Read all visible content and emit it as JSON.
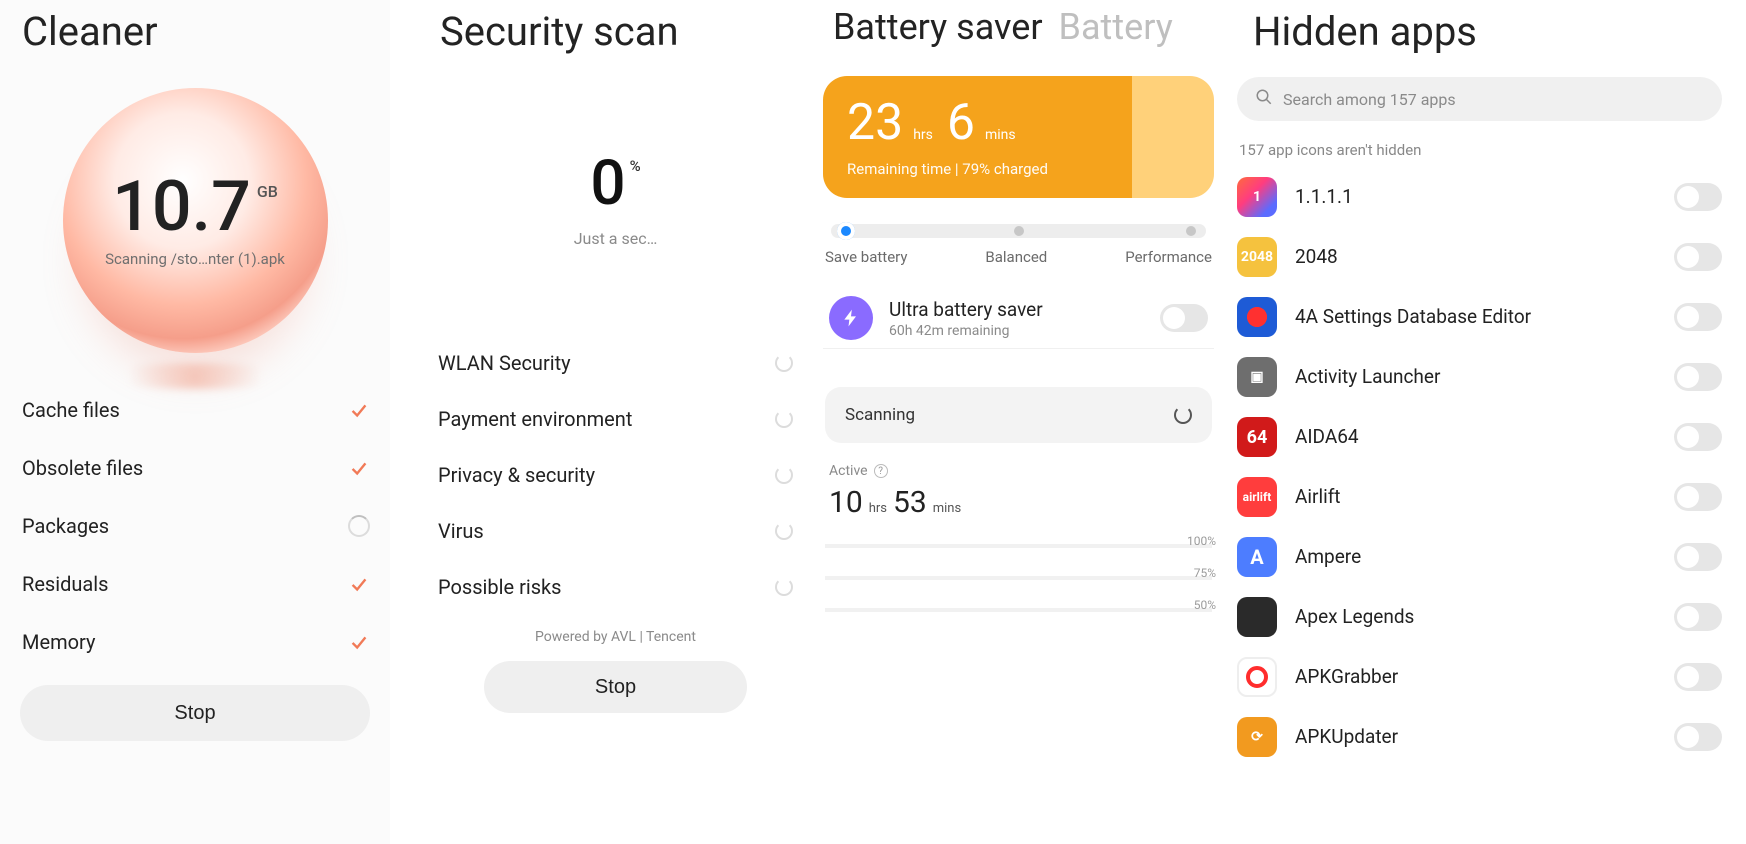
{
  "cleaner": {
    "title": "Cleaner",
    "size_value": "10.7",
    "size_unit": "GB",
    "scan_path": "Scanning /sto…nter (1).apk",
    "items": [
      {
        "label": "Cache files",
        "state": "done"
      },
      {
        "label": "Obsolete files",
        "state": "done"
      },
      {
        "label": "Packages",
        "state": "scanning"
      },
      {
        "label": "Residuals",
        "state": "done"
      },
      {
        "label": "Memory",
        "state": "done"
      }
    ],
    "stop_label": "Stop"
  },
  "security": {
    "title": "Security scan",
    "percent": "0",
    "percent_unit": "%",
    "status": "Just a sec…",
    "items": [
      "WLAN Security",
      "Payment environment",
      "Privacy & security",
      "Virus",
      "Possible risks"
    ],
    "powered": "Powered by AVL | Tencent",
    "stop_label": "Stop"
  },
  "battery": {
    "tab_active": "Battery saver",
    "tab_inactive": "Battery",
    "hours": "23",
    "hours_unit": "hrs",
    "mins": "6",
    "mins_unit": "mins",
    "subtitle": "Remaining time | 79% charged",
    "modes": {
      "save": "Save battery",
      "balanced": "Balanced",
      "performance": "Performance"
    },
    "ubs_title": "Ultra battery saver",
    "ubs_sub": "60h 42m remaining",
    "scan_label": "Scanning",
    "active_label": "Active",
    "active_hours": "10",
    "active_hours_unit": "hrs",
    "active_mins": "53",
    "active_mins_unit": "mins",
    "pct_labels": [
      "100%",
      "75%",
      "50%"
    ]
  },
  "hidden": {
    "title": "Hidden apps",
    "search_placeholder": "Search among 157 apps",
    "note": "157 app icons aren't hidden",
    "apps": [
      {
        "name": "1.1.1.1",
        "iconText": "1",
        "iconClass": "ico-1111"
      },
      {
        "name": "2048",
        "iconText": "2048",
        "iconClass": "ico-2048"
      },
      {
        "name": "4A Settings Database Editor",
        "iconText": "",
        "iconClass": "ico-4a"
      },
      {
        "name": "Activity Launcher",
        "iconText": "▣",
        "iconClass": "ico-actlaunch"
      },
      {
        "name": "AIDA64",
        "iconText": "64",
        "iconClass": "ico-aida"
      },
      {
        "name": "Airlift",
        "iconText": "airlift",
        "iconClass": "ico-airlift"
      },
      {
        "name": "Ampere",
        "iconText": "A",
        "iconClass": "ico-ampere"
      },
      {
        "name": "Apex Legends",
        "iconText": "",
        "iconClass": "ico-apex"
      },
      {
        "name": "APKGrabber",
        "iconText": "",
        "iconClass": "ico-apkgrab"
      },
      {
        "name": "APKUpdater",
        "iconText": "⟳",
        "iconClass": "ico-apkup"
      }
    ]
  }
}
